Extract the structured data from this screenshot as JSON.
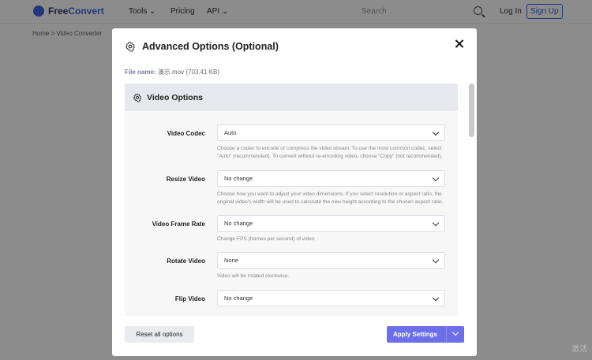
{
  "nav": {
    "brand_primary": "Free",
    "brand_accent": "Convert",
    "items": [
      "Tools",
      "Pricing",
      "API"
    ],
    "search_placeholder": "Search",
    "login": "Log In",
    "signup": "Sign Up",
    "breadcrumb": "Home  >  Video Converter"
  },
  "modal": {
    "title": "Advanced Options (Optional)",
    "file_label": "File name:",
    "file_value": "演示.mov (703.41 KB)",
    "section_title": "Video Options",
    "options": [
      {
        "label": "Video Codec",
        "value": "Auto",
        "help": "Choose a codec to encode or compress the video stream. To use the most common codec, select \"Auto\" (recommended). To convert without re-encoding video, choose \"Copy\" (not recommended)."
      },
      {
        "label": "Resize Video",
        "value": "No change",
        "help": "Choose how you want to adjust your video dimensions. If you select resolution or aspect ratio, the original video's width will be used to calculate the new height according to the chosen aspect ratio."
      },
      {
        "label": "Video Frame Rate",
        "value": "No change",
        "help": "Change FPS (frames per second) of video"
      },
      {
        "label": "Rotate Video",
        "value": "None",
        "help": "Video will be rotated clockwise."
      },
      {
        "label": "Flip Video",
        "value": "No change",
        "help": ""
      }
    ],
    "reset_label": "Reset all options",
    "apply_label": "Apply Settings"
  },
  "watermark": "激活",
  "colors": {
    "accent": "#6d6fe8",
    "brand": "#3e63dd",
    "section_bg": "#e6e8ee"
  }
}
